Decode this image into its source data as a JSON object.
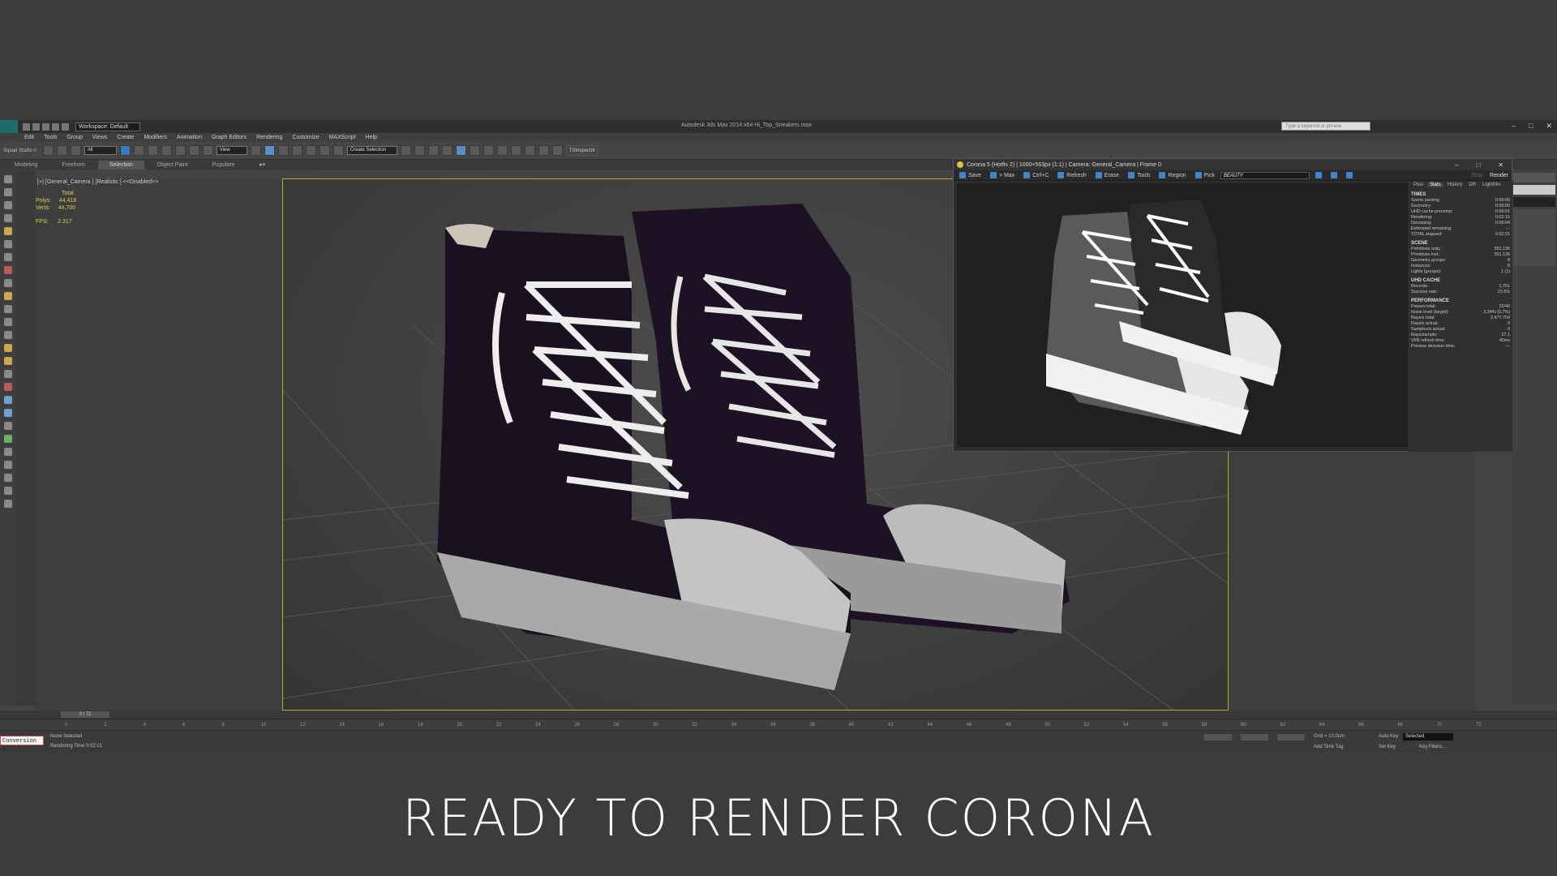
{
  "app": {
    "title": "Autodesk 3ds Max 2014 x64    Hi_Top_Sneakers.max",
    "workspace": "Workspace: Default",
    "search_placeholder": "Type a keyword or phrase"
  },
  "menu": [
    "Edit",
    "Tools",
    "Group",
    "Views",
    "Create",
    "Modifiers",
    "Animation",
    "Graph Editors",
    "Rendering",
    "Customize",
    "MAXScript",
    "Help"
  ],
  "toolbar": {
    "squad": "Squad Studio v",
    "filter_all": "All",
    "view": "View",
    "create_selection": "Create Selection",
    "ts_inspector": "TSInspector"
  },
  "ribbon": [
    "Modeling",
    "Freeform",
    "Selection",
    "Object Paint",
    "Populate"
  ],
  "viewport": {
    "label": "[+] [General_Camera ] [Realistic ]  <<Disabled>>",
    "stats": {
      "total": "Total",
      "polys_label": "Polys:",
      "polys": "44,418",
      "verts_label": "Verts:",
      "verts": "44,700",
      "fps_label": "FPS:",
      "fps": "2.317"
    }
  },
  "timeline": {
    "frame": "0 / 72",
    "ticks": [
      "0",
      "2",
      "4",
      "6",
      "8",
      "10",
      "12",
      "14",
      "16",
      "18",
      "20",
      "22",
      "24",
      "26",
      "28",
      "30",
      "32",
      "34",
      "36",
      "38",
      "40",
      "42",
      "44",
      "46",
      "48",
      "50",
      "52",
      "54",
      "56",
      "58",
      "60",
      "62",
      "64",
      "66",
      "68",
      "70",
      "72"
    ]
  },
  "status": {
    "conversion": "Conversion d",
    "selection": "None Selected",
    "rendering_time": "Rendering Time  0:02:21",
    "grid": "Grid = 10.0cm",
    "auto_key": "Auto Key",
    "selected": "Selected",
    "set_key": "Set Key",
    "key_filters": "Key Filters...",
    "add_time_tag": "Add Time Tag"
  },
  "vfb": {
    "title": "Corona 5 (Hotfix 2) | 1000×563px (1:1) | Camera: General_Camera | Frame 0",
    "buttons": [
      "Save",
      "> Max",
      "Ctrl+C",
      "Refresh",
      "Erase",
      "Tools",
      "Region",
      "Pick"
    ],
    "channel": "BEAUTY",
    "stop": "Stop",
    "render": "Render",
    "tabs": [
      "Post",
      "Stats",
      "History",
      "DR",
      "LightMix"
    ],
    "groups": [
      {
        "name": "TIMES",
        "rows": [
          [
            "Scene parsing:",
            "0:00:00"
          ],
          [
            "Geometry:",
            "0:00:00"
          ],
          [
            "UHD cache precomp:",
            "0:00:01"
          ],
          [
            "Rendering:",
            "0:02:15"
          ],
          [
            "Denoising:",
            "0:00:04"
          ],
          [
            "Estimated remaining:",
            "---"
          ],
          [
            "TOTAL elapsed:",
            "0:02:21"
          ]
        ]
      },
      {
        "name": "SCENE",
        "rows": [
          [
            "Primitives uniq.:",
            "351,136"
          ],
          [
            "Primitives inst.:",
            "351,136"
          ],
          [
            "Geometry groups:",
            "8"
          ],
          [
            "Instances:",
            "8"
          ],
          [
            "Lights (groups):",
            "1 (1)"
          ]
        ]
      },
      {
        "name": "UHD CACHE",
        "rows": [
          [
            "Records:",
            "1,751"
          ],
          [
            "Success rate:",
            "23.5%"
          ]
        ]
      },
      {
        "name": "PERFORMANCE",
        "rows": [
          [
            "Passes total:",
            "22/40"
          ],
          [
            "Noise level (target):",
            "3.34% (0.7%)"
          ],
          [
            "Rays/s total:",
            "2,477,754"
          ],
          [
            "Rays/s actual:",
            "0"
          ],
          [
            "Samples/s actual:",
            "0"
          ],
          [
            "Rays/sample:",
            "27.1"
          ],
          [
            "VFB refresh time:",
            "45ms"
          ],
          [
            "Preview denoiser time:",
            "---"
          ]
        ]
      }
    ]
  },
  "caption": "READY TO RENDER  CORONA",
  "colors": {
    "viewport_border": "#b5ad2c",
    "stats_text": "#d6d24a",
    "accent_blue": "#3e86c9"
  }
}
